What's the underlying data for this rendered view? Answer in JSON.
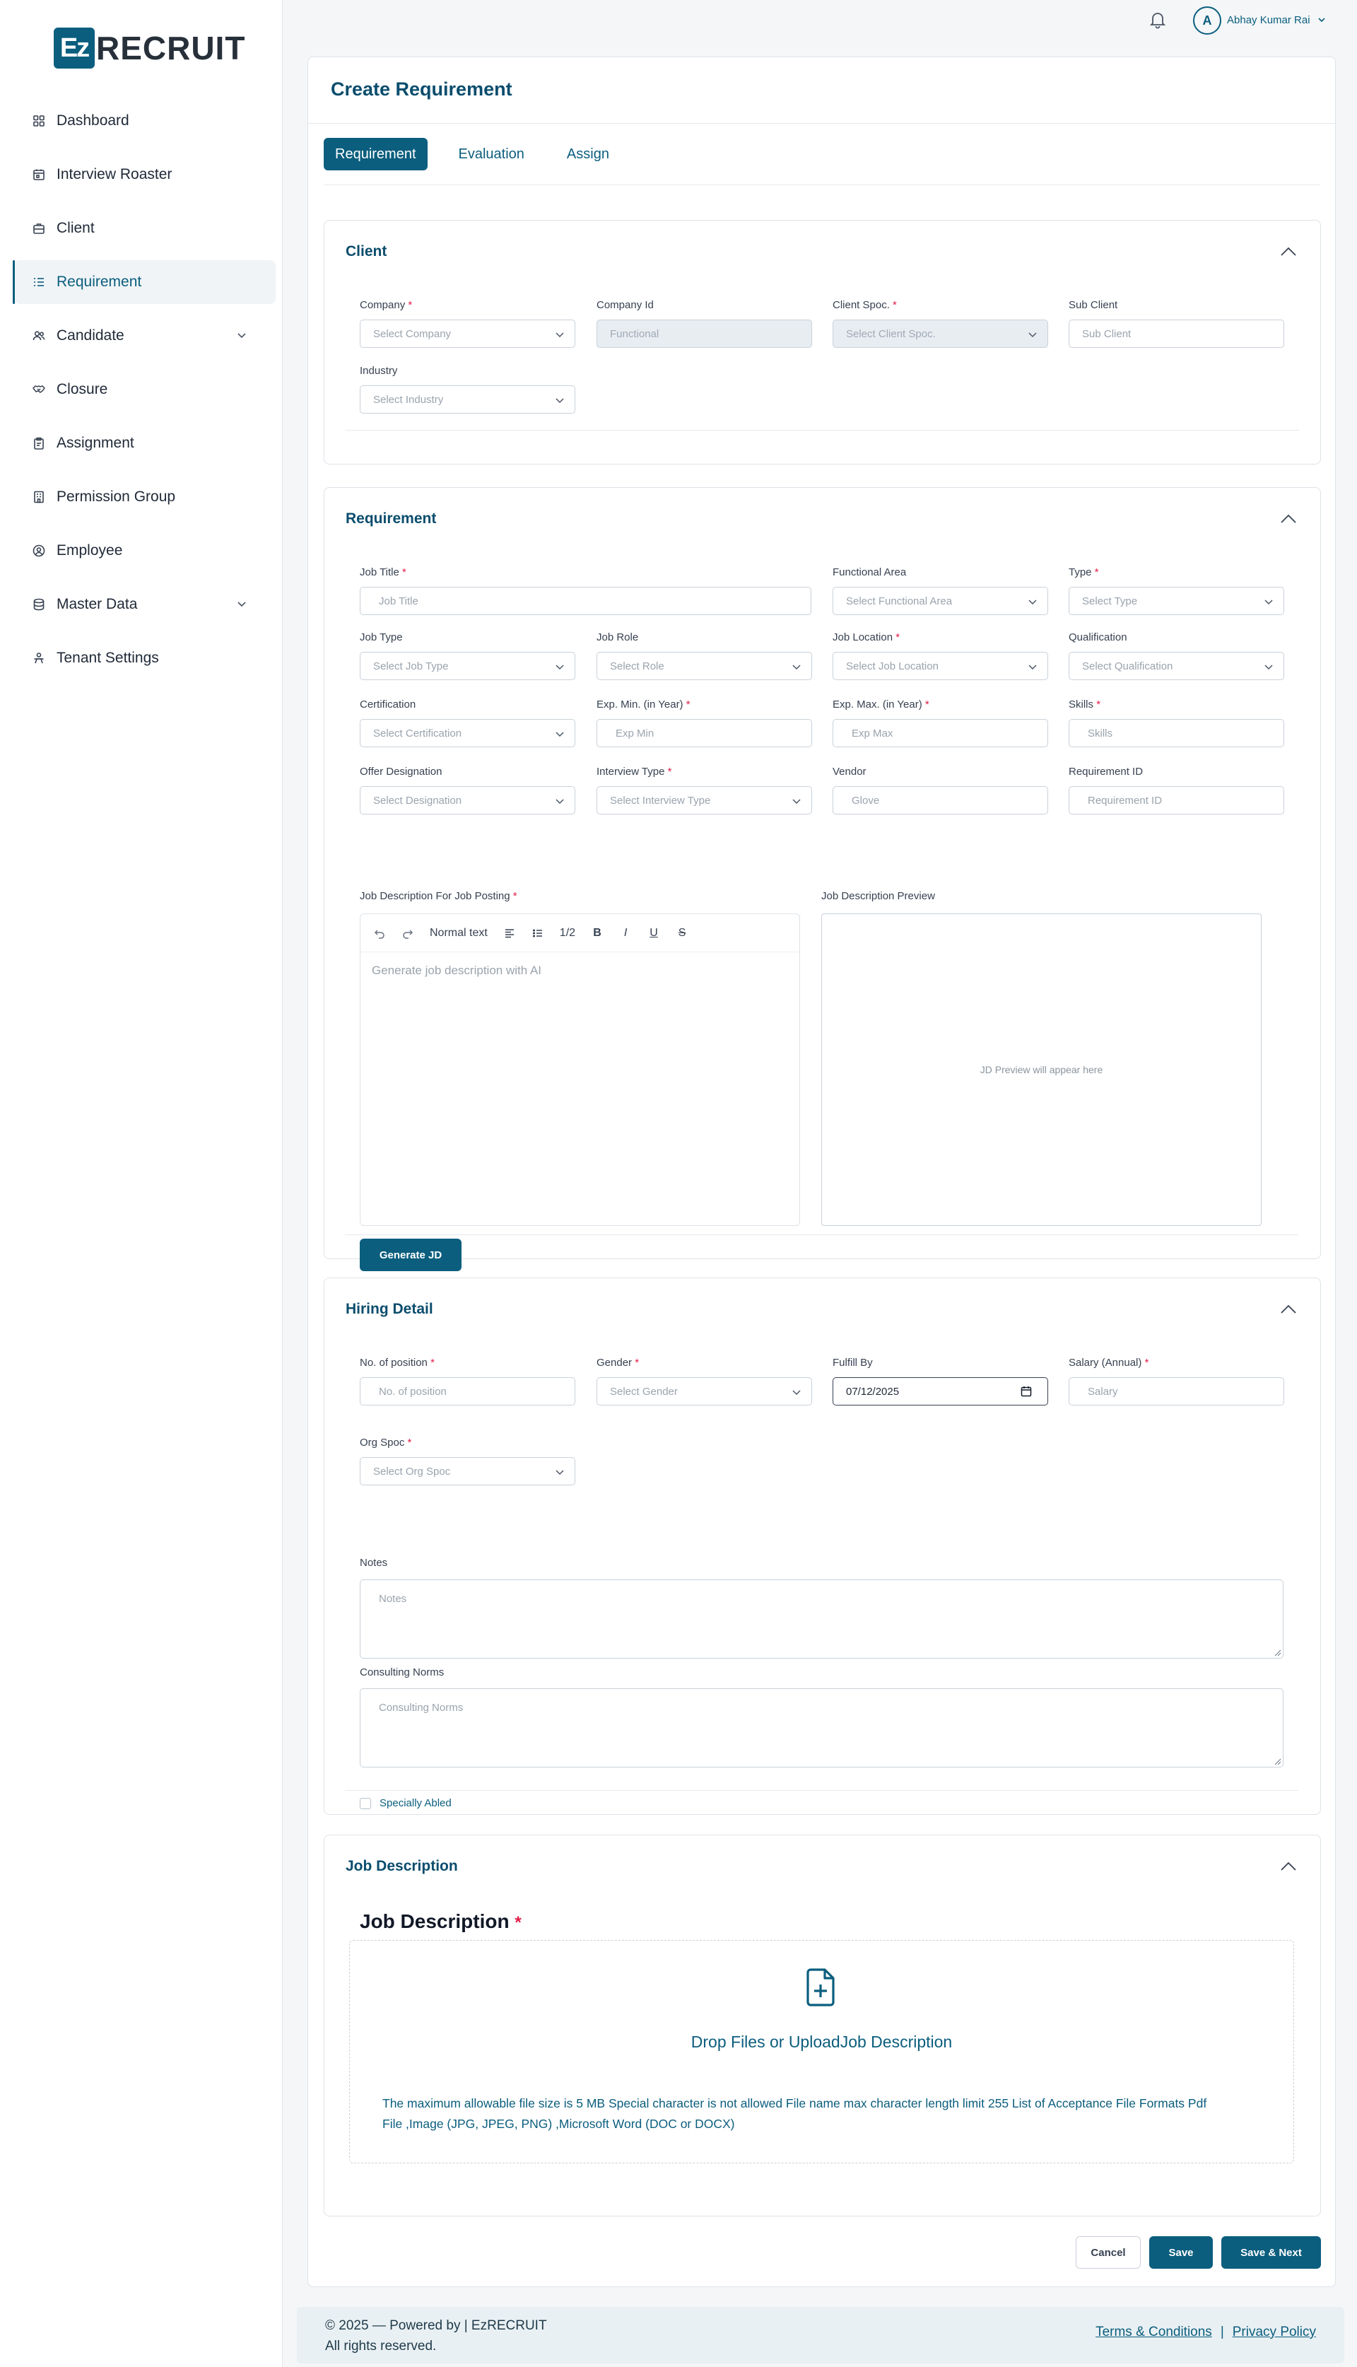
{
  "brand": {
    "logo_mark": "Ez",
    "logo_text": "RECRUIT"
  },
  "sidebar": {
    "items": [
      {
        "label": "Dashboard",
        "icon": "grid-icon"
      },
      {
        "label": "Interview Roaster",
        "icon": "calendar-icon"
      },
      {
        "label": "Client",
        "icon": "briefcase-icon"
      },
      {
        "label": "Requirement",
        "icon": "list-icon",
        "active": true
      },
      {
        "label": "Candidate",
        "icon": "users-icon",
        "expandable": true
      },
      {
        "label": "Closure",
        "icon": "handshake-icon"
      },
      {
        "label": "Assignment",
        "icon": "clipboard-icon"
      },
      {
        "label": "Permission Group",
        "icon": "building-icon"
      },
      {
        "label": "Employee",
        "icon": "user-circle-icon"
      },
      {
        "label": "Master Data",
        "icon": "database-icon",
        "expandable": true
      },
      {
        "label": "Tenant Settings",
        "icon": "person-settings-icon"
      }
    ]
  },
  "topbar": {
    "avatar_initial": "A",
    "user_name": "Abhay Kumar Rai"
  },
  "page": {
    "title": "Create Requirement"
  },
  "tabs": [
    {
      "label": "Requirement",
      "active": true
    },
    {
      "label": "Evaluation"
    },
    {
      "label": "Assign"
    }
  ],
  "client_section": {
    "title": "Client",
    "fields": {
      "company": {
        "label": "Company",
        "required": "*",
        "placeholder": "Select Company"
      },
      "company_id": {
        "label": "Company Id",
        "value": "Functional"
      },
      "client_spoc": {
        "label": "Client Spoc.",
        "required": "*",
        "placeholder": "Select Client Spoc."
      },
      "sub_client": {
        "label": "Sub Client",
        "placeholder": "Sub Client"
      },
      "industry": {
        "label": "Industry",
        "placeholder": "Select Industry"
      }
    }
  },
  "requirement_section": {
    "title": "Requirement",
    "fields": {
      "job_title": {
        "label": "Job Title",
        "required": "*",
        "placeholder": "Job Title"
      },
      "functional_area": {
        "label": "Functional Area",
        "placeholder": "Select Functional Area"
      },
      "type": {
        "label": "Type",
        "required": "*",
        "placeholder": "Select Type"
      },
      "job_type": {
        "label": "Job Type",
        "placeholder": "Select Job Type"
      },
      "job_role": {
        "label": "Job Role",
        "placeholder": "Select Role"
      },
      "job_location": {
        "label": "Job Location",
        "required": "*",
        "placeholder": "Select Job Location"
      },
      "qualification": {
        "label": "Qualification",
        "placeholder": "Select Qualification"
      },
      "certification": {
        "label": "Certification",
        "placeholder": "Select Certification"
      },
      "exp_min": {
        "label": "Exp. Min. (in Year)",
        "required": "*",
        "placeholder": "Exp Min"
      },
      "exp_max": {
        "label": "Exp. Max. (in Year)",
        "required": "*",
        "placeholder": "Exp Max"
      },
      "skills": {
        "label": "Skills",
        "required": "*",
        "placeholder": "Skills"
      },
      "offer_designation": {
        "label": "Offer Designation",
        "placeholder": "Select Designation"
      },
      "interview_type": {
        "label": "Interview Type",
        "required": "*",
        "placeholder": "Select Interview Type"
      },
      "vendor": {
        "label": "Vendor",
        "value": "Glove"
      },
      "requirement_id": {
        "label": "Requirement ID",
        "placeholder": "Requirement ID"
      }
    },
    "jd_posting": {
      "label": "Job Description For Job Posting",
      "required": "*",
      "toolbar": {
        "text_style": "Normal text",
        "heading": "1/2",
        "bold": "B",
        "italic": "I",
        "underline": "U",
        "strike": "S"
      },
      "placeholder": "Generate job description with AI"
    },
    "jd_preview": {
      "label": "Job Description Preview",
      "placeholder": "JD Preview will appear here"
    },
    "generate_button": "Generate JD"
  },
  "hiring_section": {
    "title": "Hiring Detail",
    "fields": {
      "positions": {
        "label": "No. of position",
        "required": "*",
        "placeholder": "No. of position"
      },
      "gender": {
        "label": "Gender",
        "required": "*",
        "placeholder": "Select Gender"
      },
      "fulfill_by": {
        "label": "Fulfill By",
        "value": "07/12/2025"
      },
      "salary": {
        "label": "Salary (Annual)",
        "required": "*",
        "placeholder": "Salary"
      },
      "org_spoc": {
        "label": "Org Spoc",
        "required": "*",
        "placeholder": "Select Org Spoc"
      },
      "notes": {
        "label": "Notes",
        "placeholder": "Notes"
      },
      "consulting_norms": {
        "label": "Consulting Norms",
        "placeholder": "Consulting Norms"
      }
    },
    "specially_abled": "Specially Abled"
  },
  "jd_section": {
    "title": "Job Description",
    "upload_heading": "Job Description",
    "required": "*",
    "drop_text": "Drop Files or UploadJob Description",
    "note_line1": "The maximum allowable file size is 5 MB Special character is not allowed File name max character length limit 255 List of Acceptance File Formats Pdf",
    "note_line2": "File ,Image (JPG, JPEG, PNG) ,Microsoft Word (DOC or DOCX)"
  },
  "actions": {
    "cancel": "Cancel",
    "save": "Save",
    "save_next": "Save & Next"
  },
  "footer": {
    "copyright": "© 2025 — Powered by | EzRECRUIT",
    "rights": "All rights reserved.",
    "terms": "Terms & Conditions",
    "separator": "|",
    "privacy": "Privacy Policy"
  },
  "colors": {
    "primary": "#0b5e7e",
    "required": "#e11d48",
    "title": "#0b4d6d"
  }
}
